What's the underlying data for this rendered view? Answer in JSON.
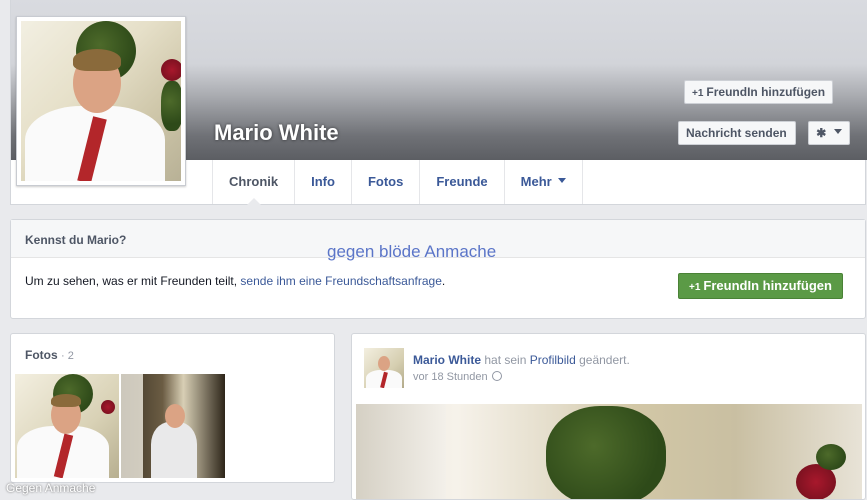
{
  "profile": {
    "name": "Mario White",
    "add_friend_label": "FreundIn hinzufügen",
    "message_label": "Nachricht senden",
    "gear_symbol": "✱"
  },
  "tabs": [
    {
      "label": "Chronik",
      "active": true
    },
    {
      "label": "Info"
    },
    {
      "label": "Fotos"
    },
    {
      "label": "Freunde"
    },
    {
      "label": "Mehr"
    }
  ],
  "know_box": {
    "heading": "Kennst du Mario?",
    "text_before": "Um zu sehen, was er mit Freunden teilt, ",
    "link_text": "sende ihm eine Freundschaftsanfrage",
    "text_after": ".",
    "button_label": "FreundIn hinzufügen"
  },
  "photos": {
    "heading": "Fotos",
    "count": "· 2"
  },
  "post": {
    "author": "Mario White",
    "action_before": "hat sein",
    "action_link": "Profilbild",
    "action_after": "geändert.",
    "time": "vor 18 Stunden"
  },
  "watermarks": {
    "middle": "gegen blöde Anmache",
    "bottom_left": "Gegen Anmache"
  },
  "colors": {
    "link_blue": "#3b5998",
    "green_button": "#5b9a46",
    "page_bg": "#e9eaed"
  }
}
